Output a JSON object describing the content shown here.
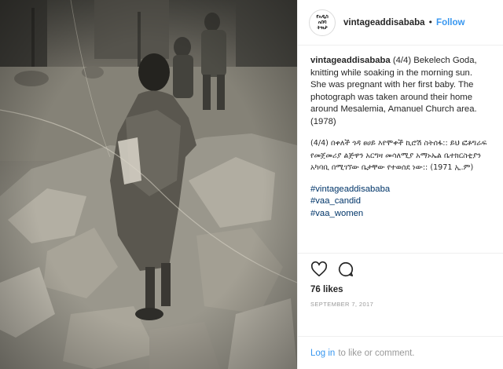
{
  "post": {
    "username": "vintageaddisababa",
    "separator": "•",
    "follow_label": "Follow",
    "avatar_text": [
      "የአዲስ",
      "አበባ",
      "ትዝታ"
    ],
    "caption_en": "(4/4) Bekelech Goda, knitting while soaking in the morning sun. She was pregnant with her first baby. The photograph was taken around their home around Mesalemia, Amanuel Church area. (1978)",
    "caption_am": "(4/4) በቀለች ጎዳ ፀሀይ እየሞቀች ኪሮሽ ስትሰፋ:: ይህ ፎቶግራፍ የመጀመሪያ ልጅዋን አርግዛ መሳለሚያ አማኑኤል ቤተክርስቲያን አካባቢ በሚገኘው ቤታቸው የተወሰደ ነው:: (1971 ኢ.ም)",
    "hashtags": [
      "#vintageaddisababa",
      "#vaa_candid",
      "#vaa_women"
    ],
    "likes": "76 likes",
    "date": "SEPTEMBER 7, 2017",
    "login_label": "Log in",
    "comment_prompt": "to like or comment.",
    "icons": {
      "like": "heart-icon",
      "comment": "comment-bubble-icon"
    }
  },
  "colors": {
    "accent": "#3897f0",
    "hashtag": "#003569",
    "muted": "#999999",
    "text": "#262626"
  }
}
